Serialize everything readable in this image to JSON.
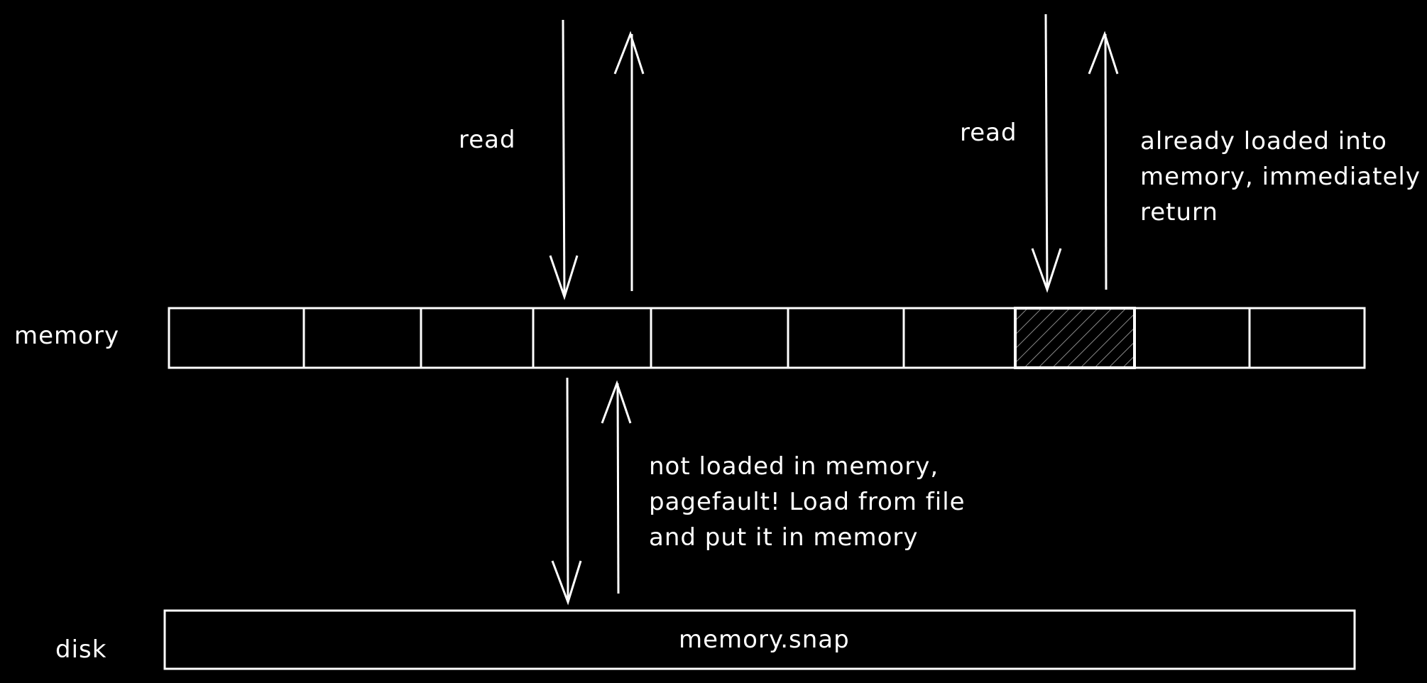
{
  "labels": {
    "memory": "memory",
    "disk": "disk",
    "read_left": "read",
    "read_right": "read",
    "already_loaded": [
      "already loaded into",
      "memory, immediately",
      "return"
    ],
    "not_loaded": [
      "not loaded in memory,",
      "pagefault! Load from file",
      "and put it in memory"
    ],
    "disk_file": "memory.snap"
  },
  "memory": {
    "cell_count": 10,
    "hatched_cell_index": 7
  },
  "colors": {
    "background": "#000000",
    "stroke": "#ffffff",
    "hatch": "#8a8a8a"
  }
}
